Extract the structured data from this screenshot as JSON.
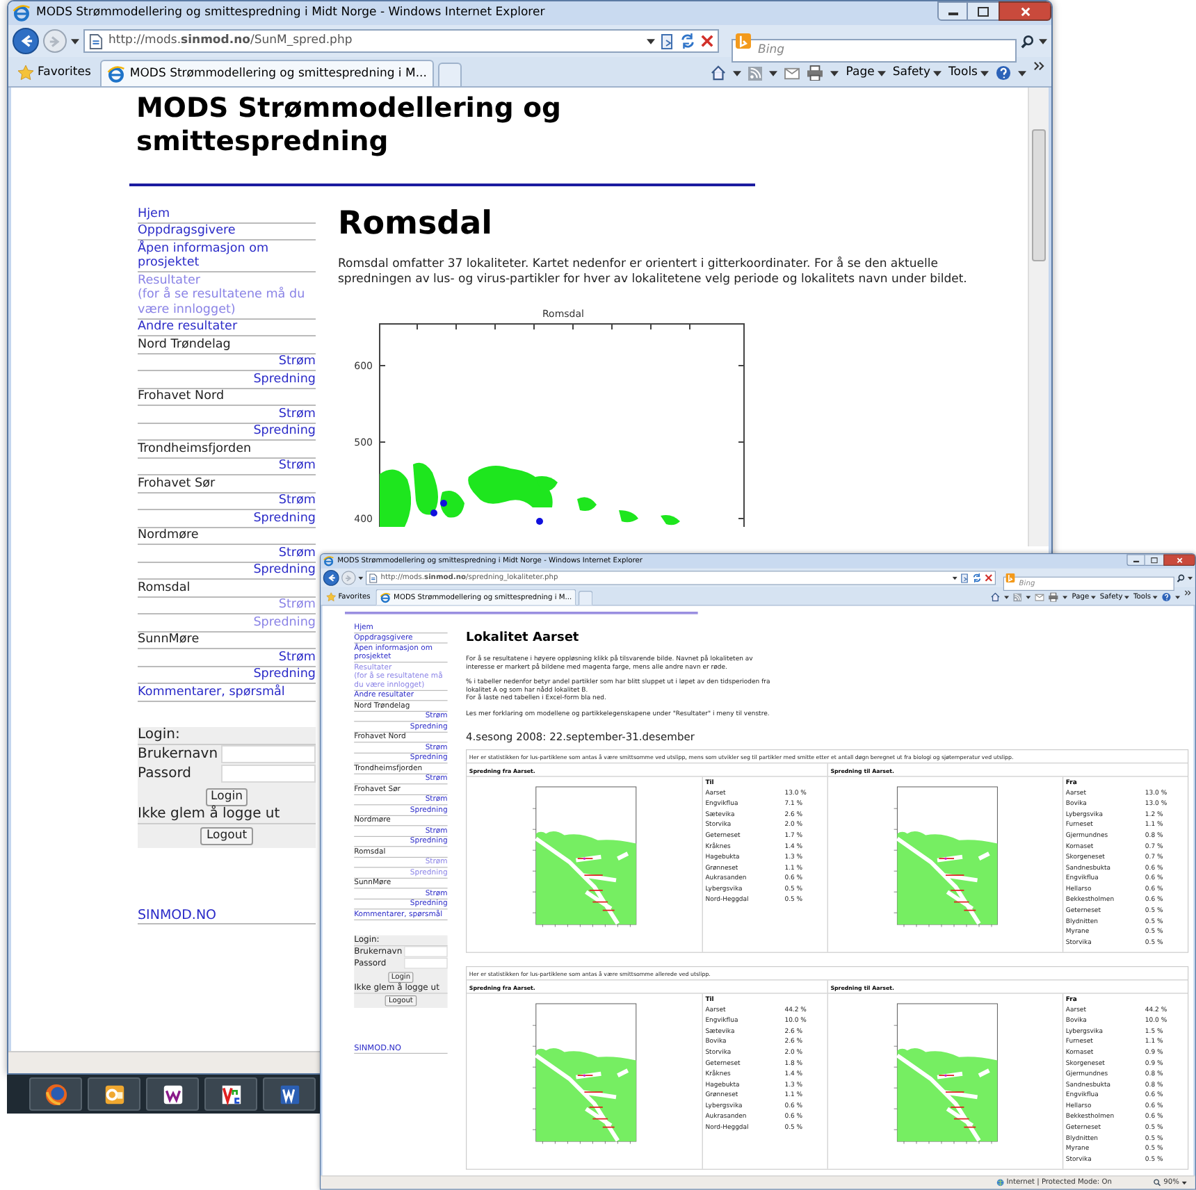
{
  "windows": [
    {
      "title": "MODS Strømmodellering og smittespredning i Midt Norge - Windows Internet Explorer",
      "url": "http://mods.**sinmod.no**/SunM_spred.php",
      "search_placeholder": "Bing",
      "favorites": "Favorites",
      "tab_title": "MODS Strømmodellering og smittespredning i M...",
      "menus": [
        "Page",
        "Safety",
        "Tools"
      ],
      "page": {
        "site_title": "MODS Strømmodellering og smittespredning",
        "nav": [
          {
            "kind": "link",
            "text": "Hjem",
            "visited": false
          },
          {
            "kind": "link",
            "text": "Oppdragsgivere",
            "visited": false
          },
          {
            "kind": "link",
            "text": "Åpen informasjon om prosjektet",
            "visited": false
          },
          {
            "kind": "link",
            "text": "Resultater",
            "note": "(for å se resultatene må du være innlogget)",
            "visited": true
          },
          {
            "kind": "link",
            "text": "Andre resultater",
            "visited": false
          },
          {
            "kind": "heading",
            "text": "Nord Trøndelag",
            "visited": false
          },
          {
            "kind": "sub",
            "text": "Strøm",
            "visited": false
          },
          {
            "kind": "sub",
            "text": "Spredning",
            "visited": false
          },
          {
            "kind": "heading",
            "text": "Frohavet Nord",
            "visited": false
          },
          {
            "kind": "sub",
            "text": "Strøm",
            "visited": false
          },
          {
            "kind": "sub",
            "text": "Spredning",
            "visited": false
          },
          {
            "kind": "heading",
            "text": "Trondheimsfjorden",
            "visited": false
          },
          {
            "kind": "sub",
            "text": "Strøm",
            "visited": false
          },
          {
            "kind": "heading",
            "text": "Frohavet Sør",
            "visited": false
          },
          {
            "kind": "sub",
            "text": "Strøm",
            "visited": false
          },
          {
            "kind": "sub",
            "text": "Spredning",
            "visited": false
          },
          {
            "kind": "heading",
            "text": "Nordmøre",
            "visited": false
          },
          {
            "kind": "sub",
            "text": "Strøm",
            "visited": false
          },
          {
            "kind": "sub",
            "text": "Spredning",
            "visited": false
          },
          {
            "kind": "heading",
            "text": "Romsdal",
            "visited": false
          },
          {
            "kind": "sub",
            "text": "Strøm",
            "visited": true
          },
          {
            "kind": "sub",
            "text": "Spredning",
            "visited": true
          },
          {
            "kind": "heading",
            "text": "SunnMøre",
            "visited": false
          },
          {
            "kind": "sub",
            "text": "Strøm",
            "visited": false
          },
          {
            "kind": "sub",
            "text": "Spredning",
            "visited": false
          },
          {
            "kind": "link",
            "text": "Kommentarer, spørsmål",
            "visited": false
          }
        ],
        "login": {
          "title": "Login:",
          "username_label": "Brukernavn",
          "password_label": "Passord",
          "login_button": "Login",
          "reminder": "Ikke glem å logge ut",
          "logout_button": "Logout"
        },
        "footer_link": "SINMOD.NO",
        "content": {
          "kind": "region",
          "heading": "Romsdal",
          "text": "Romsdal omfatter 37 lokaliteter. Kartet nedenfor er orientert i gitterkoordinater. For å se den aktuelle spredningen av lus- og virus-partikler for hver av lokalitetene velg periode og lokalitets navn under bildet.",
          "map": {
            "title": "Romsdal",
            "y_labels": [
              "600",
              "500",
              "400"
            ]
          }
        }
      }
    },
    {
      "title": "MODS Strømmodellering og smittespredning i Midt Norge - Windows Internet Explorer",
      "url": "http://mods.**sinmod.no**/spredning_lokaliteter.php",
      "search_placeholder": "Bing",
      "favorites": "Favorites",
      "tab_title": "MODS Strømmodellering og smittespredning i M...",
      "menus": [
        "Page",
        "Safety",
        "Tools"
      ],
      "status": {
        "zone": "Internet | Protected Mode: On",
        "zoom": "90%"
      },
      "page": {
        "nav": [
          {
            "kind": "link",
            "text": "Hjem",
            "visited": false
          },
          {
            "kind": "link",
            "text": "Oppdragsgivere",
            "visited": false
          },
          {
            "kind": "link",
            "text": "Åpen informasjon om prosjektet",
            "visited": false
          },
          {
            "kind": "link",
            "text": "Resultater",
            "note": "(for å se resultatene må du være innlogget)",
            "visited": true
          },
          {
            "kind": "link",
            "text": "Andre resultater",
            "visited": false
          },
          {
            "kind": "heading",
            "text": "Nord Trøndelag",
            "visited": false
          },
          {
            "kind": "sub",
            "text": "Strøm",
            "visited": false
          },
          {
            "kind": "sub",
            "text": "Spredning",
            "visited": false
          },
          {
            "kind": "heading",
            "text": "Frohavet Nord",
            "visited": false
          },
          {
            "kind": "sub",
            "text": "Strøm",
            "visited": false
          },
          {
            "kind": "sub",
            "text": "Spredning",
            "visited": false
          },
          {
            "kind": "heading",
            "text": "Trondheimsfjorden",
            "visited": false
          },
          {
            "kind": "sub",
            "text": "Strøm",
            "visited": false
          },
          {
            "kind": "heading",
            "text": "Frohavet Sør",
            "visited": false
          },
          {
            "kind": "sub",
            "text": "Strøm",
            "visited": false
          },
          {
            "kind": "sub",
            "text": "Spredning",
            "visited": false
          },
          {
            "kind": "heading",
            "text": "Nordmøre",
            "visited": false
          },
          {
            "kind": "sub",
            "text": "Strøm",
            "visited": false
          },
          {
            "kind": "sub",
            "text": "Spredning",
            "visited": false
          },
          {
            "kind": "heading",
            "text": "Romsdal",
            "visited": false
          },
          {
            "kind": "sub",
            "text": "Strøm",
            "visited": true
          },
          {
            "kind": "sub",
            "text": "Spredning",
            "visited": true
          },
          {
            "kind": "heading",
            "text": "SunnMøre",
            "visited": false
          },
          {
            "kind": "sub",
            "text": "Strøm",
            "visited": false
          },
          {
            "kind": "sub",
            "text": "Spredning",
            "visited": false
          },
          {
            "kind": "link",
            "text": "Kommentarer, spørsmål",
            "visited": false
          }
        ],
        "login": {
          "title": "Login:",
          "username_label": "Brukernavn",
          "password_label": "Passord",
          "login_button": "Login",
          "reminder": "Ikke glem å logge ut",
          "logout_button": "Logout"
        },
        "footer_link": "SINMOD.NO",
        "content": {
          "kind": "locality",
          "heading": "Lokalitet Aarset",
          "paragraphs": [
            "For å se resultatene i høyere oppløsning klikk på tilsvarende bilde. Navnet på lokaliteten av interesse er markert på bildene med magenta farge, mens alle andre navn er røde.",
            "% i tabeller nedenfor betyr andel partikler som har blitt sluppet ut i løpet av den tidsperioden fra lokalitet A og som har nådd lokalitet B.",
            "For å laste ned tabellen i Excel-form bla ned.",
            "Les mer forklaring om modellene og partikkelegenskapene under \"Resultater\" i meny til venstre."
          ],
          "period": "4.sesong 2008: 22.september-31.desember",
          "blocks": [
            {
              "caption": "Her er statistikken for lus-partiklene som antas å være smittsomme ved utslipp, mens som utvikler seg til partikler med smitte etter et antall døgn beregnet ut fra biologi og sjøtemperatur ved utslipp.",
              "panels": [
                {
                  "title": "Spredning fra Aarset.",
                  "list_header": "Til",
                  "rows": [
                    {
                      "name": "Aarset",
                      "value": "13.0 %"
                    },
                    {
                      "name": "Engvikflua",
                      "value": "7.1 %"
                    },
                    {
                      "name": "Sætevika",
                      "value": "2.6 %"
                    },
                    {
                      "name": "Storvika",
                      "value": "2.0 %"
                    },
                    {
                      "name": "Geterneset",
                      "value": "1.7 %"
                    },
                    {
                      "name": "Kråknes",
                      "value": "1.4 %"
                    },
                    {
                      "name": "Hagebukta",
                      "value": "1.3 %"
                    },
                    {
                      "name": "Grønneset",
                      "value": "1.1 %"
                    },
                    {
                      "name": "Aukrasanden",
                      "value": "0.6 %"
                    },
                    {
                      "name": "Lybergsvika",
                      "value": "0.5 %"
                    },
                    {
                      "name": "Nord-Heggdal",
                      "value": "0.5 %"
                    }
                  ]
                },
                {
                  "title": "Spredning til Aarset.",
                  "list_header": "Fra",
                  "rows": [
                    {
                      "name": "Aarset",
                      "value": "13.0 %"
                    },
                    {
                      "name": "Bovika",
                      "value": "13.0 %"
                    },
                    {
                      "name": "Lybergsvika",
                      "value": "1.2 %"
                    },
                    {
                      "name": "Furneset",
                      "value": "1.1 %"
                    },
                    {
                      "name": "Gjermundnes",
                      "value": "0.8 %"
                    },
                    {
                      "name": "Kornaset",
                      "value": "0.7 %"
                    },
                    {
                      "name": "Skorgeneset",
                      "value": "0.7 %"
                    },
                    {
                      "name": "Sandnesbukta",
                      "value": "0.6 %"
                    },
                    {
                      "name": "Engvikflua",
                      "value": "0.6 %"
                    },
                    {
                      "name": "Hellarso",
                      "value": "0.6 %"
                    },
                    {
                      "name": "Bekkestholmen",
                      "value": "0.6 %"
                    },
                    {
                      "name": "Geterneset",
                      "value": "0.5 %"
                    },
                    {
                      "name": "Blydnitten",
                      "value": "0.5 %"
                    },
                    {
                      "name": "Myrane",
                      "value": "0.5 %"
                    },
                    {
                      "name": "Storvika",
                      "value": "0.5 %"
                    }
                  ]
                }
              ]
            },
            {
              "caption": "Her er statistikken for lus-partiklene som antas å være smittsomme allerede ved utslipp.",
              "panels": [
                {
                  "title": "Spredning fra Aarset.",
                  "list_header": "Til",
                  "rows": [
                    {
                      "name": "Aarset",
                      "value": "44.2 %"
                    },
                    {
                      "name": "Engvikflua",
                      "value": "10.0 %"
                    },
                    {
                      "name": "Sætevika",
                      "value": "2.6 %"
                    },
                    {
                      "name": "Bovika",
                      "value": "2.6 %"
                    },
                    {
                      "name": "Storvika",
                      "value": "2.0 %"
                    },
                    {
                      "name": "Geterneset",
                      "value": "1.8 %"
                    },
                    {
                      "name": "Kråknes",
                      "value": "1.4 %"
                    },
                    {
                      "name": "Hagebukta",
                      "value": "1.3 %"
                    },
                    {
                      "name": "Grønneset",
                      "value": "1.1 %"
                    },
                    {
                      "name": "Lybergsvika",
                      "value": "0.6 %"
                    },
                    {
                      "name": "Aukrasanden",
                      "value": "0.6 %"
                    },
                    {
                      "name": "Nord-Heggdal",
                      "value": "0.5 %"
                    }
                  ]
                },
                {
                  "title": "Spredning til Aarset.",
                  "list_header": "Fra",
                  "rows": [
                    {
                      "name": "Aarset",
                      "value": "44.2 %"
                    },
                    {
                      "name": "Bovika",
                      "value": "10.0 %"
                    },
                    {
                      "name": "Lybergsvika",
                      "value": "1.5 %"
                    },
                    {
                      "name": "Furneset",
                      "value": "1.1 %"
                    },
                    {
                      "name": "Kornaset",
                      "value": "0.9 %"
                    },
                    {
                      "name": "Skorgeneset",
                      "value": "0.9 %"
                    },
                    {
                      "name": "Gjermundnes",
                      "value": "0.8 %"
                    },
                    {
                      "name": "Sandnesbukta",
                      "value": "0.8 %"
                    },
                    {
                      "name": "Engvikflua",
                      "value": "0.6 %"
                    },
                    {
                      "name": "Hellarso",
                      "value": "0.6 %"
                    },
                    {
                      "name": "Bekkestholmen",
                      "value": "0.6 %"
                    },
                    {
                      "name": "Geterneset",
                      "value": "0.5 %"
                    },
                    {
                      "name": "Blydnitten",
                      "value": "0.5 %"
                    },
                    {
                      "name": "Myrane",
                      "value": "0.5 %"
                    },
                    {
                      "name": "Storvika",
                      "value": "0.5 %"
                    }
                  ]
                }
              ]
            }
          ]
        }
      }
    }
  ]
}
